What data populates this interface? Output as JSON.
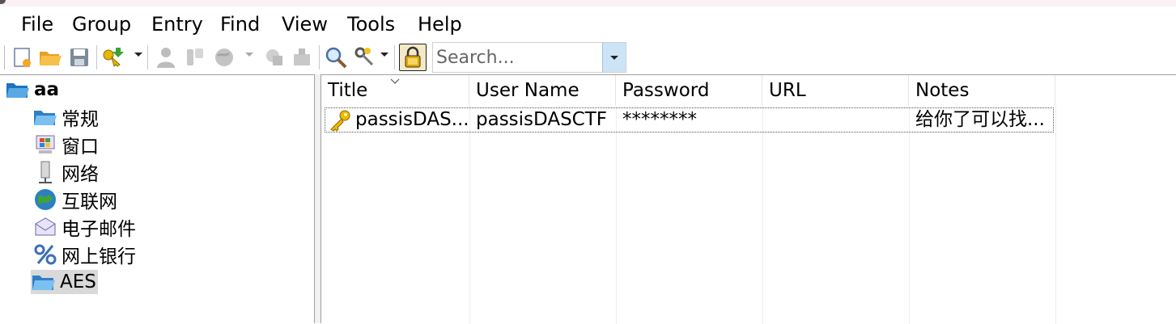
{
  "menu": [
    "File",
    "Group",
    "Entry",
    "Find",
    "View",
    "Tools",
    "Help"
  ],
  "toolbar": {
    "search_placeholder": "Search..."
  },
  "tree": {
    "root": "aa",
    "groups": [
      "常规",
      "窗口",
      "网络",
      "互联网",
      "电子邮件",
      "网上银行",
      "AES"
    ],
    "selected": "AES"
  },
  "columns": [
    "Title",
    "User Name",
    "Password",
    "URL",
    "Notes"
  ],
  "entries": [
    {
      "title": "passisDAS...",
      "username": "passisDASCTF",
      "password": "********",
      "url": "",
      "notes": "给你了可以找..."
    }
  ],
  "colors": {
    "selection": "#d9d9d9",
    "search_dropdown": "#cde4f7",
    "menu_bg": "#ffffff"
  }
}
